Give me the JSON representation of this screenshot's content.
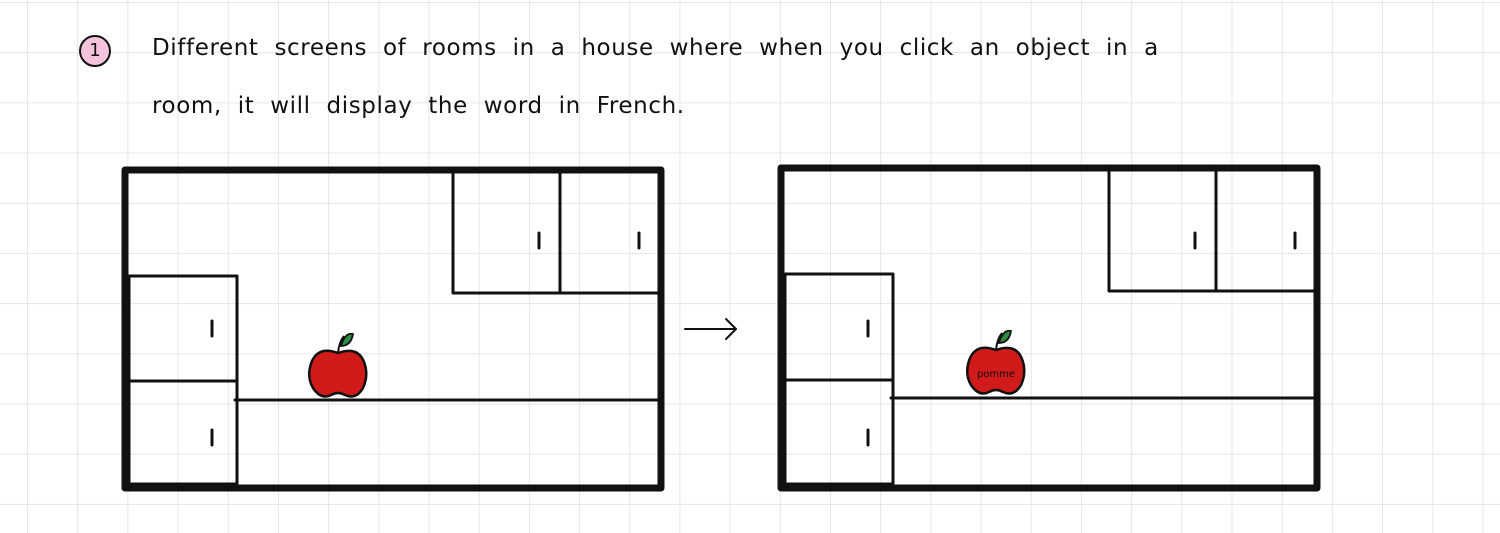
{
  "step": {
    "number": "1",
    "badge_color": "#f5c3dc"
  },
  "description": {
    "line1": "Different screens of rooms in a house where when you click an object in a",
    "line2": "room, it will display the word in French."
  },
  "scenes": [
    {
      "state": "before",
      "object": "apple-icon",
      "label": ""
    },
    {
      "state": "after",
      "object": "apple-icon",
      "label": "pomme"
    }
  ],
  "colors": {
    "apple": "#d11a1a",
    "leaf": "#2e8a3e",
    "ink": "#111111",
    "grid": "#e3e6ea"
  }
}
